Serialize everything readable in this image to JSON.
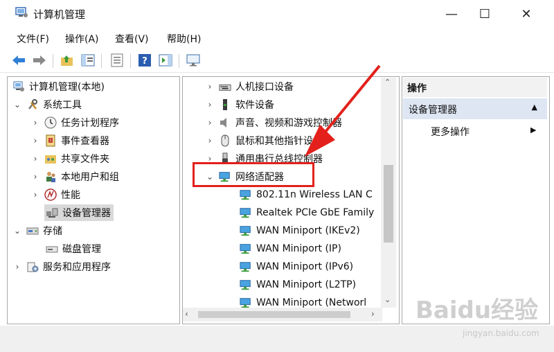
{
  "window": {
    "title": "计算机管理",
    "controls": [
      "minimize-icon",
      "maximize-icon",
      "close-icon"
    ]
  },
  "menubar": [
    {
      "label": "文件(F)"
    },
    {
      "label": "操作(A)"
    },
    {
      "label": "查看(V)"
    },
    {
      "label": "帮助(H)"
    }
  ],
  "toolbar": [
    "back-arrow-icon",
    "forward-arrow-icon",
    "up-folder-icon",
    "show-hide-tree-icon",
    "properties-icon",
    "help-icon",
    "action-pane-icon",
    "monitor-icon"
  ],
  "left_tree": [
    {
      "label": "计算机管理(本地)",
      "icon": "computer-management-icon"
    },
    {
      "label": "系统工具",
      "icon": "tools-icon",
      "expanded": true
    },
    {
      "label": "任务计划程序",
      "icon": "clock-icon"
    },
    {
      "label": "事件查看器",
      "icon": "event-viewer-icon"
    },
    {
      "label": "共享文件夹",
      "icon": "shared-folder-icon"
    },
    {
      "label": "本地用户和组",
      "icon": "users-icon"
    },
    {
      "label": "性能",
      "icon": "performance-icon"
    },
    {
      "label": "设备管理器",
      "icon": "device-manager-icon",
      "selected": true
    },
    {
      "label": "存储",
      "icon": "storage-icon",
      "expanded": true
    },
    {
      "label": "磁盘管理",
      "icon": "disk-icon"
    },
    {
      "label": "服务和应用程序",
      "icon": "services-icon"
    }
  ],
  "device_tree": [
    {
      "label": "人机接口设备",
      "icon": "hid-icon"
    },
    {
      "label": "软件设备",
      "icon": "software-device-icon"
    },
    {
      "label": "声音、视频和游戏控制器",
      "icon": "speaker-icon"
    },
    {
      "label": "鼠标和其他指针设备",
      "icon": "mouse-icon"
    },
    {
      "label": "通用串行总线控制器",
      "icon": "usb-icon"
    },
    {
      "label": "网络适配器",
      "icon": "network-adapter-icon",
      "expanded": true
    }
  ],
  "network_adapters": [
    {
      "label": "802.11n Wireless LAN C"
    },
    {
      "label": "Realtek PCIe GbE Family"
    },
    {
      "label": "WAN Miniport (IKEv2)"
    },
    {
      "label": "WAN Miniport (IP)"
    },
    {
      "label": "WAN Miniport (IPv6)"
    },
    {
      "label": "WAN Miniport (L2TP)"
    },
    {
      "label": "WAN Miniport (Networl"
    }
  ],
  "actions": {
    "header": "操作",
    "section": "设备管理器",
    "item": "更多操作"
  },
  "watermark": {
    "main": "Baidu经验",
    "sub": "jingyan.baidu.com"
  },
  "colors": {
    "highlight": "#e3201b",
    "action_section_bg": "#dde6f2",
    "selection_bg": "#d9d9d9"
  }
}
